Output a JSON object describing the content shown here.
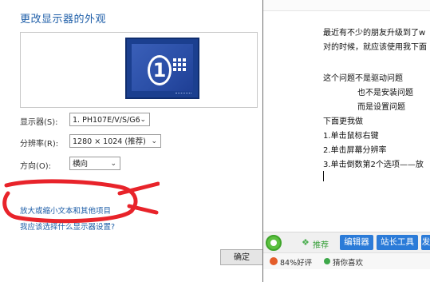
{
  "display_settings": {
    "title": "更改显示器的外观",
    "monitor_number": "1",
    "display_label": "显示器(S):",
    "display_value": "1. PH107E/V/S/G6",
    "resolution_label": "分辨率(R):",
    "resolution_value": "1280 × 1024 (推荐)",
    "orientation_label": "方向(O):",
    "orientation_value": "横向",
    "link_text_size": "放大或缩小文本和其他项目",
    "link_which_settings": "我应该选择什么显示器设置?",
    "ok_button": "确定",
    "annotation_color": "#e8232a"
  },
  "article": {
    "lines": [
      "最近有不少的朋友升级到了w",
      "对的时候，就应该使用我下面",
      "这个问题不是驱动问题",
      "也不是安装问题",
      "而是设置问题",
      "下面更我做",
      "1.单击鼠标右键",
      "2.单击屏幕分辨率",
      "3.单击倒数第2个选项——放"
    ]
  },
  "toolbar": {
    "recommend": "推荐",
    "editor": "编辑器",
    "webmaster_tools": "站长工具",
    "more": "发",
    "accent": "#2b7bd8"
  },
  "statusbar": {
    "rating": "84%好评",
    "guess_like": "猜你喜欢"
  }
}
